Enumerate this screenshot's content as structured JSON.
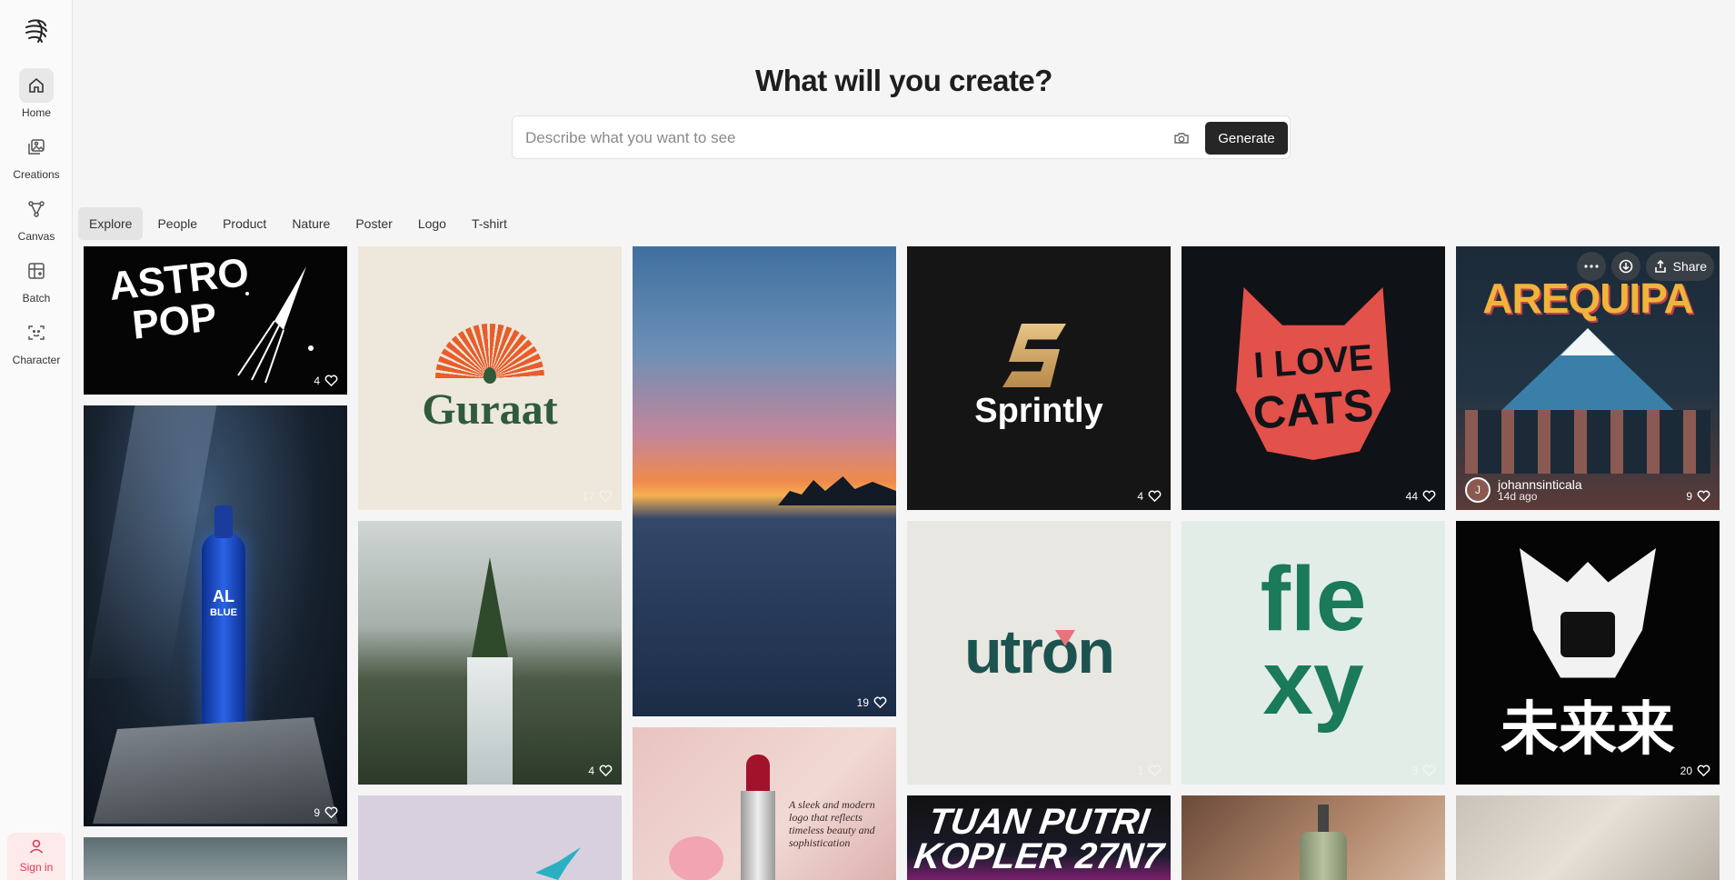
{
  "sidebar": {
    "items": [
      {
        "label": "Home",
        "icon": "home-icon"
      },
      {
        "label": "Creations",
        "icon": "images-icon"
      },
      {
        "label": "Canvas",
        "icon": "canvas-icon"
      },
      {
        "label": "Batch",
        "icon": "batch-icon"
      },
      {
        "label": "Character",
        "icon": "character-icon"
      }
    ],
    "signin_label": "Sign in"
  },
  "header": {
    "title": "What will you create?",
    "search_placeholder": "Describe what you want to see",
    "generate_label": "Generate"
  },
  "tabs": [
    "Explore",
    "People",
    "Product",
    "Nature",
    "Poster",
    "Logo",
    "T-shirt"
  ],
  "grid": {
    "astro_text_1": "ASTRO",
    "astro_text_2": "POP",
    "astro_likes": "4",
    "guraat_text": "Guraat",
    "guraat_likes": "17",
    "sunset_likes": "19",
    "sprintly_text": "Sprintly",
    "sprintly_likes": "4",
    "cats_text_1": "I LOVE",
    "cats_text_2": "CATS",
    "cats_likes": "44",
    "arequipa_text": "AREQUIPA",
    "arequipa_likes": "9",
    "arequipa_author": "johannsinticala",
    "arequipa_author_initial": "J",
    "arequipa_time": "14d ago",
    "share_label": "Share",
    "vodka_text_1": "AL",
    "vodka_text_2": "BLUE",
    "vodka_likes": "9",
    "waterfall_likes": "4",
    "utron_text": "utron",
    "utron_likes": "1",
    "flexy_text_1": "fle",
    "flexy_text_2": "xy",
    "flexy_likes": "3",
    "samurai_text": "未来来",
    "samurai_likes": "20",
    "lipstick_text": "A sleek and modern logo that reflects timeless beauty and sophistication",
    "poster_text_1": "TUAN PUTRI",
    "poster_text_2": "KOPLER 27N7"
  },
  "colors": {
    "accent_signin": "#d93a55",
    "generate_bg": "#262626"
  }
}
